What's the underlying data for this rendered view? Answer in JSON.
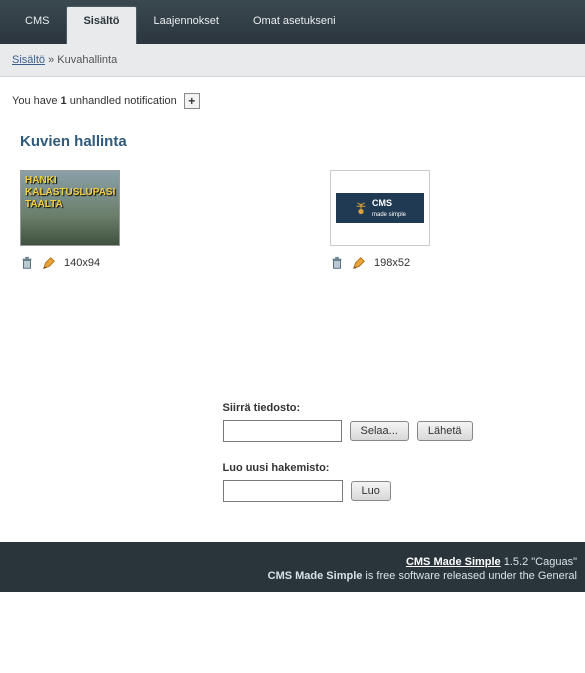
{
  "nav": {
    "tabs": [
      {
        "label": "CMS"
      },
      {
        "label": "Sisältö"
      },
      {
        "label": "Laajennokset"
      },
      {
        "label": "Omat asetukseni"
      }
    ],
    "active_index": 1
  },
  "breadcrumb": {
    "parent": "Sisältö",
    "sep": "»",
    "current": "Kuvahallinta"
  },
  "notification": {
    "prefix": "You have ",
    "count": "1",
    "suffix": " unhandled notification",
    "plus": "+"
  },
  "page_title": "Kuvien hallinta",
  "thumbs": [
    {
      "overlay_l1": "HANKI",
      "overlay_l2": "KALASTUSLUPASI",
      "overlay_l3": "TAALTA",
      "dims": "140x94"
    },
    {
      "brand": "CMS",
      "tag": "made simple",
      "dims": "198x52"
    }
  ],
  "form1": {
    "label": "Siirrä tiedosto:",
    "browse": "Selaa...",
    "submit": "Lähetä"
  },
  "form2": {
    "label": "Luo uusi hakemisto:",
    "submit": "Luo"
  },
  "footer": {
    "product": "CMS Made Simple",
    "version": " 1.5.2 \"Caguas\"",
    "line2a": "CMS Made Simple",
    "line2b": " is free software released under the General"
  }
}
